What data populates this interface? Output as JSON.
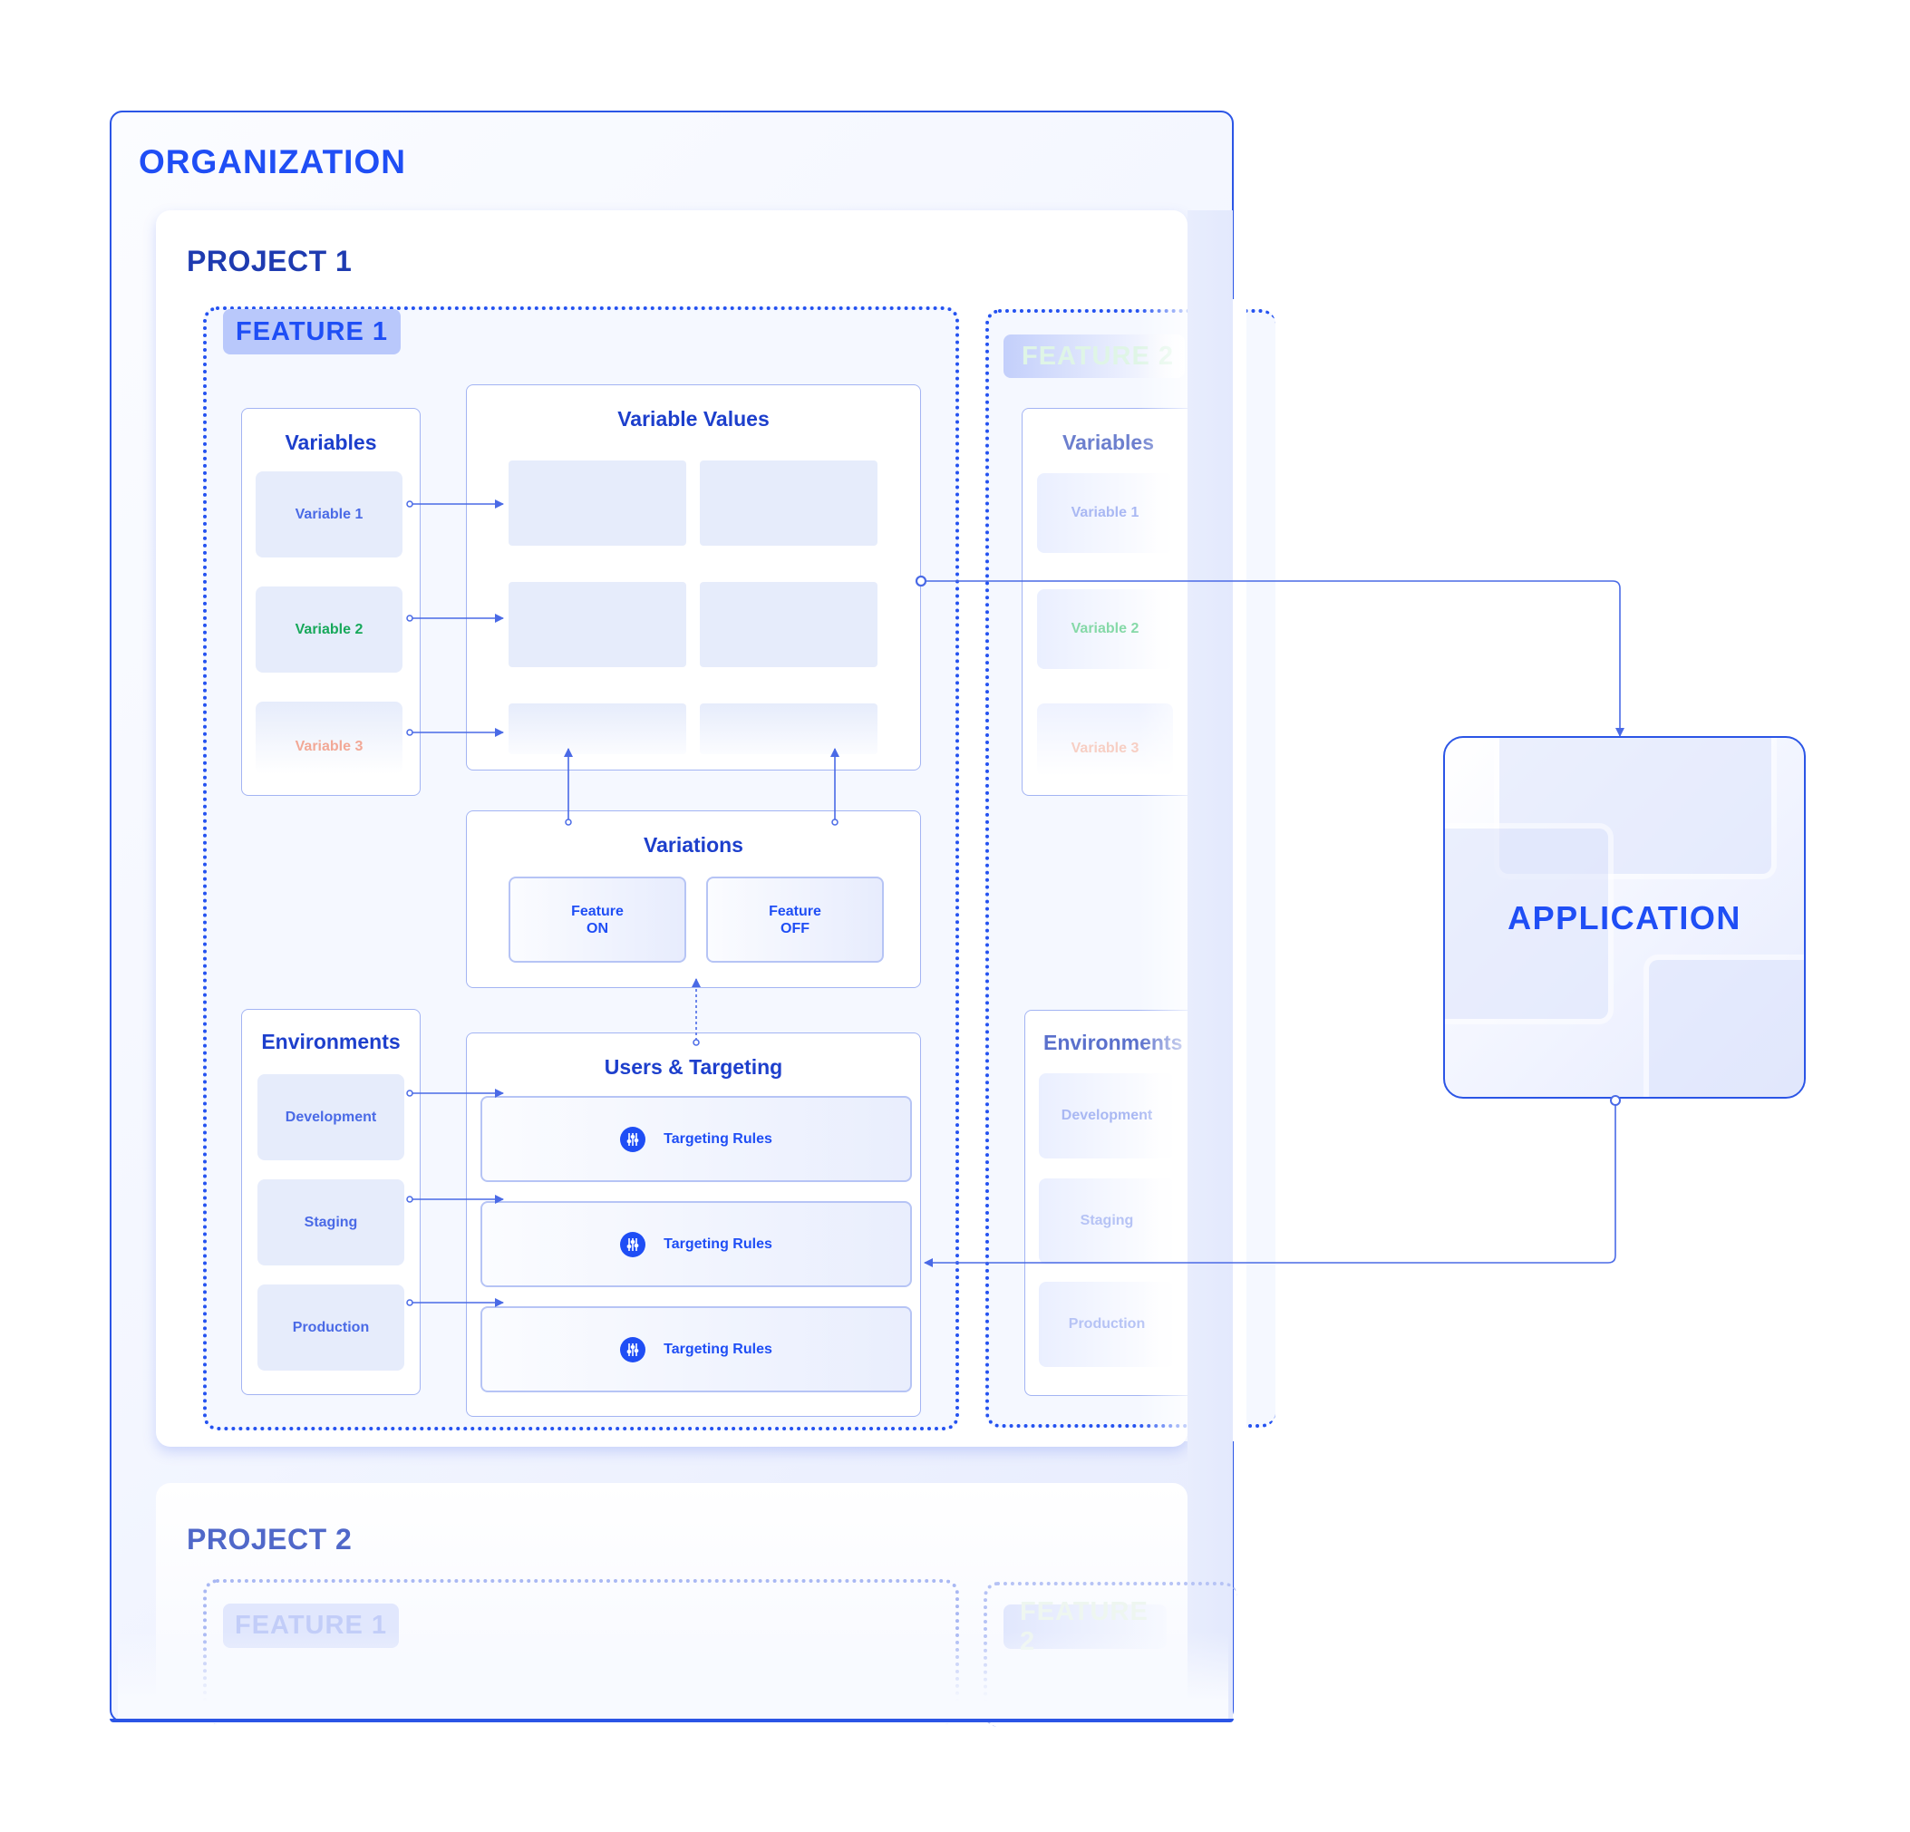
{
  "organization": {
    "title": "ORGANIZATION"
  },
  "projects": [
    {
      "title": "PROJECT 1",
      "features": [
        {
          "label": "FEATURE 1",
          "variables": {
            "title": "Variables",
            "items": [
              {
                "label": "Variable 1",
                "color": "#4a6ae6"
              },
              {
                "label": "Variable 2",
                "color": "#17a85a"
              },
              {
                "label": "Variable 3",
                "color": "#f2a896"
              }
            ]
          },
          "variable_values": {
            "title": "Variable Values"
          },
          "variations": {
            "title": "Variations",
            "items": [
              {
                "line1": "Feature",
                "line2": "ON"
              },
              {
                "line1": "Feature",
                "line2": "OFF"
              }
            ]
          },
          "environments": {
            "title": "Environments",
            "items": [
              "Development",
              "Staging",
              "Production"
            ]
          },
          "users_targeting": {
            "title": "Users & Targeting",
            "rules": [
              "Targeting Rules",
              "Targeting Rules",
              "Targeting Rules"
            ],
            "rule_icon": "sliders-icon"
          }
        },
        {
          "label": "FEATURE 2",
          "variables": {
            "title": "Variables",
            "items": [
              {
                "label": "Variable 1"
              },
              {
                "label": "Variable 2"
              },
              {
                "label": "Variable 3"
              }
            ]
          },
          "environments": {
            "title": "Environments",
            "items": [
              "Development",
              "Staging",
              "Production"
            ]
          }
        }
      ]
    },
    {
      "title": "PROJECT 2",
      "features": [
        {
          "label": "FEATURE 1"
        },
        {
          "label": "FEATURE 2"
        }
      ]
    }
  ],
  "application": {
    "title": "APPLICATION"
  },
  "colors": {
    "accent": "#1f4ef5",
    "title_dark": "#1e3bb0",
    "line": "#4a6ae6",
    "green": "#17a85a",
    "salmon": "#f2a896"
  }
}
